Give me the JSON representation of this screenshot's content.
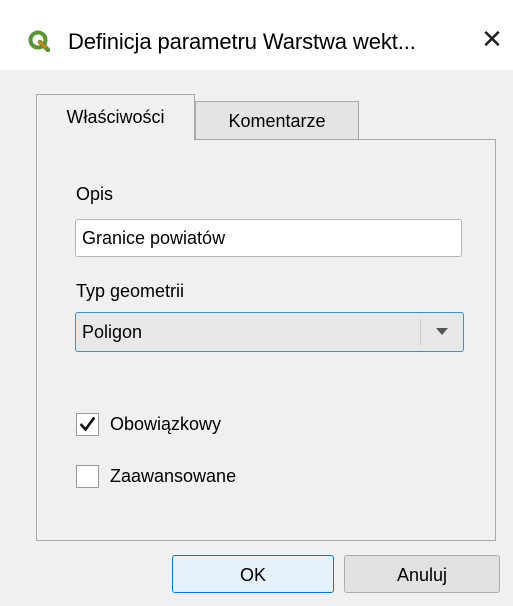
{
  "window": {
    "title": "Definicja parametru Warstwa wekt...",
    "app_icon": "qgis-logo-icon",
    "close_icon": "close-icon",
    "close_glyph": "✕"
  },
  "tabs": [
    {
      "label": "Właściwości",
      "active": true
    },
    {
      "label": "Komentarze",
      "active": false
    }
  ],
  "form": {
    "description_label": "Opis",
    "description_value": "Granice powiatów",
    "geometry_label": "Typ geometrii",
    "geometry_value": "Poligon",
    "required_label": "Obowiązkowy",
    "required_checked": true,
    "advanced_label": "Zaawansowane",
    "advanced_checked": false
  },
  "buttons": {
    "ok_label": "OK",
    "cancel_label": "Anuluj"
  },
  "colors": {
    "accent": "#0078d7",
    "qgis_green": "#589632",
    "qgis_yellow": "#ee7913"
  }
}
